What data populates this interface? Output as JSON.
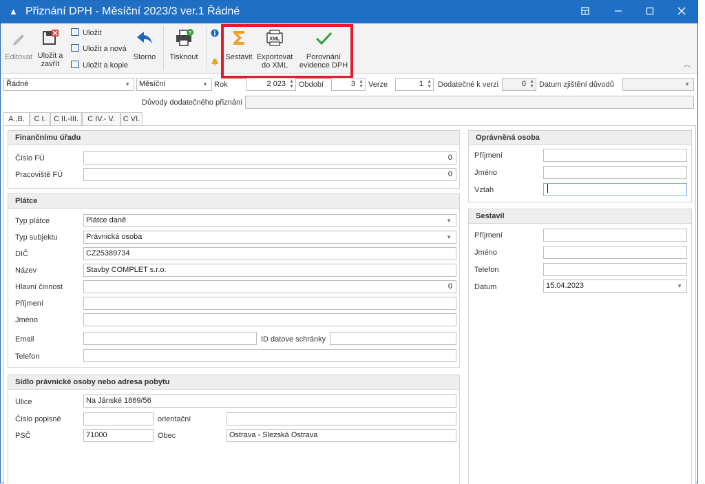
{
  "window": {
    "title": "Přiznání DPH - Měsíční 2023/3 ver.1 Řádné",
    "app_icon": "▲",
    "controls": [
      "restore-icon",
      "minimize-icon",
      "maximize-icon",
      "close-icon"
    ]
  },
  "ribbon": {
    "edit": "Editovat",
    "save_close_line1": "Uložit a",
    "save_close_line2": "zavřít",
    "save": "Uložit",
    "save_new": "Uložit a nová",
    "save_copy": "Uložit a kopie",
    "cancel": "Storno",
    "print": "Tisknout",
    "compile": "Sestavit",
    "export_line1": "Exportovat",
    "export_line2": "do XML",
    "compare_line1": "Porovnání",
    "compare_line2": "evidence DPH",
    "xml_icon_text": "XML"
  },
  "filters": {
    "type": "Řádné",
    "period_type": "Měsíční",
    "year_label": "Rok",
    "year": "2 023",
    "period_label": "Období",
    "period": "3",
    "version_label": "Verze",
    "version": "1",
    "additional_label": "Dodatečné k verzi",
    "additional": "0",
    "date_label": "Datum zjištění důvodů",
    "date": "",
    "reasons_label": "Důvody dodatečného přiznání",
    "reasons": ""
  },
  "tabs": [
    "A.,B.",
    "C I.",
    "C II.-III.",
    "C IV.- V.",
    "C VI."
  ],
  "tax_office": {
    "title": "Finančnímu úřadu",
    "office_label": "Číslo FÚ",
    "office_value": "0",
    "workplace_label": "Pracoviště FÚ",
    "workplace_value": "0"
  },
  "payer": {
    "title": "Plátce",
    "type_label": "Typ plátce",
    "type_value": "Plátce daně",
    "subject_label": "Typ subjektu",
    "subject_value": "Právnická osoba",
    "dic_label": "DIČ",
    "dic_value": "CZ25389734",
    "name_label": "Název",
    "name_value": "Stavby COMPLET s.r.o.",
    "activity_label": "Hlavní činnost",
    "activity_value": "0",
    "surname_label": "Příjmení",
    "surname_value": "",
    "firstname_label": "Jméno",
    "firstname_value": "",
    "email_label": "Email",
    "email_value": "",
    "databox_label": "ID datove schránky",
    "databox_value": "",
    "phone_label": "Telefon",
    "phone_value": ""
  },
  "address": {
    "title": "Sídlo právnické osoby nebo adresa pobytu",
    "street_label": "Ulice",
    "street_value": "Na Jánské 1869/56",
    "house_label": "Číslo popisné",
    "house_value": "",
    "orient_label": "orientační",
    "orient_value": "",
    "zip_label": "PSČ",
    "zip_value": "71000",
    "city_label": "Obec",
    "city_value": "Ostrava - Slezská Ostrava"
  },
  "authorized": {
    "title": "Oprávněná osoba",
    "surname_label": "Příjmení",
    "surname_value": "",
    "firstname_label": "Jméno",
    "firstname_value": "",
    "relation_label": "Vztah",
    "relation_value": ""
  },
  "compiled_by": {
    "title": "Sestavil",
    "surname_label": "Příjmení",
    "surname_value": "",
    "firstname_label": "Jméno",
    "firstname_value": "",
    "phone_label": "Telefon",
    "phone_value": "",
    "date_label": "Datum",
    "date_value": "15.04.2023"
  },
  "colors": {
    "titlebar": "#1f6fc5",
    "highlight": "#e21b2a",
    "sum_icon": "#f0a020",
    "check_icon": "#2e9d3a",
    "undo_icon": "#1a67b8"
  }
}
